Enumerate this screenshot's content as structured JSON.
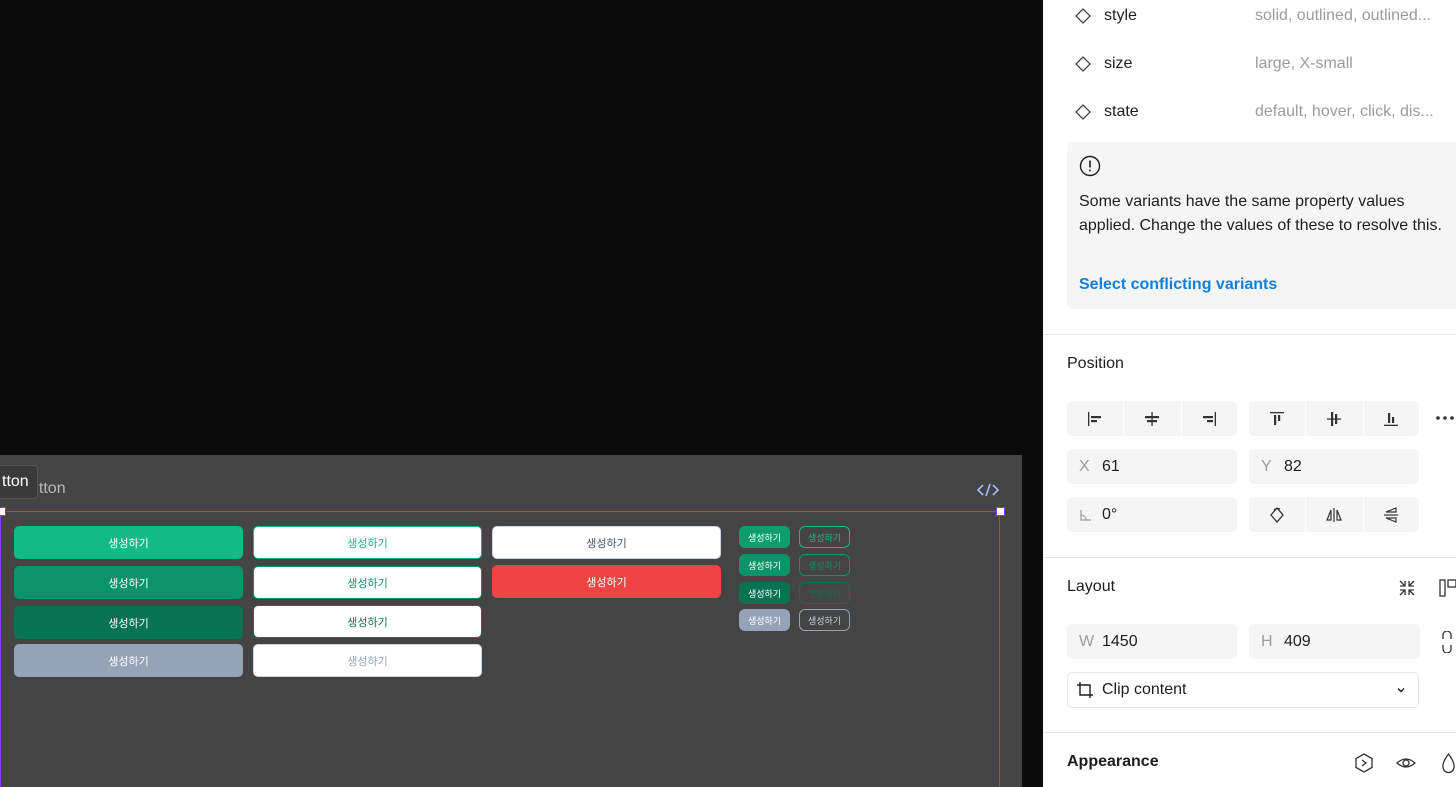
{
  "canvas": {
    "frame_tag": "tton",
    "frame_label": "utton",
    "buttons": {
      "label": "생성하기",
      "col1_colors": [
        "#12bb85",
        "#0a9467",
        "#077351",
        "#94a3b8"
      ],
      "col2_text_colors": [
        "#12bb85",
        "#0a9467",
        "#077351",
        "#94a3b8"
      ],
      "col3_colors": [
        "#ffffff",
        "#ef4444"
      ],
      "small_fill_colors": [
        "#0f9d6e",
        "#0a9467",
        "#077351",
        "#94a3b8"
      ]
    }
  },
  "panel": {
    "properties": [
      {
        "name": "style",
        "value": "solid, outlined, outlined..."
      },
      {
        "name": "size",
        "value": "large, X-small"
      },
      {
        "name": "state",
        "value": "default, hover, click, dis..."
      }
    ],
    "warning": {
      "text": "Some variants have the same property values applied. Change the values of these to resolve this.",
      "link": "Select conflicting variants"
    },
    "position": {
      "title": "Position",
      "x_label": "X",
      "x": "61",
      "y_label": "Y",
      "y": "82",
      "rotation": "0°"
    },
    "layout": {
      "title": "Layout",
      "w_label": "W",
      "w": "1450",
      "h_label": "H",
      "h": "409",
      "clip": "Clip content"
    },
    "appearance": {
      "title": "Appearance"
    }
  }
}
